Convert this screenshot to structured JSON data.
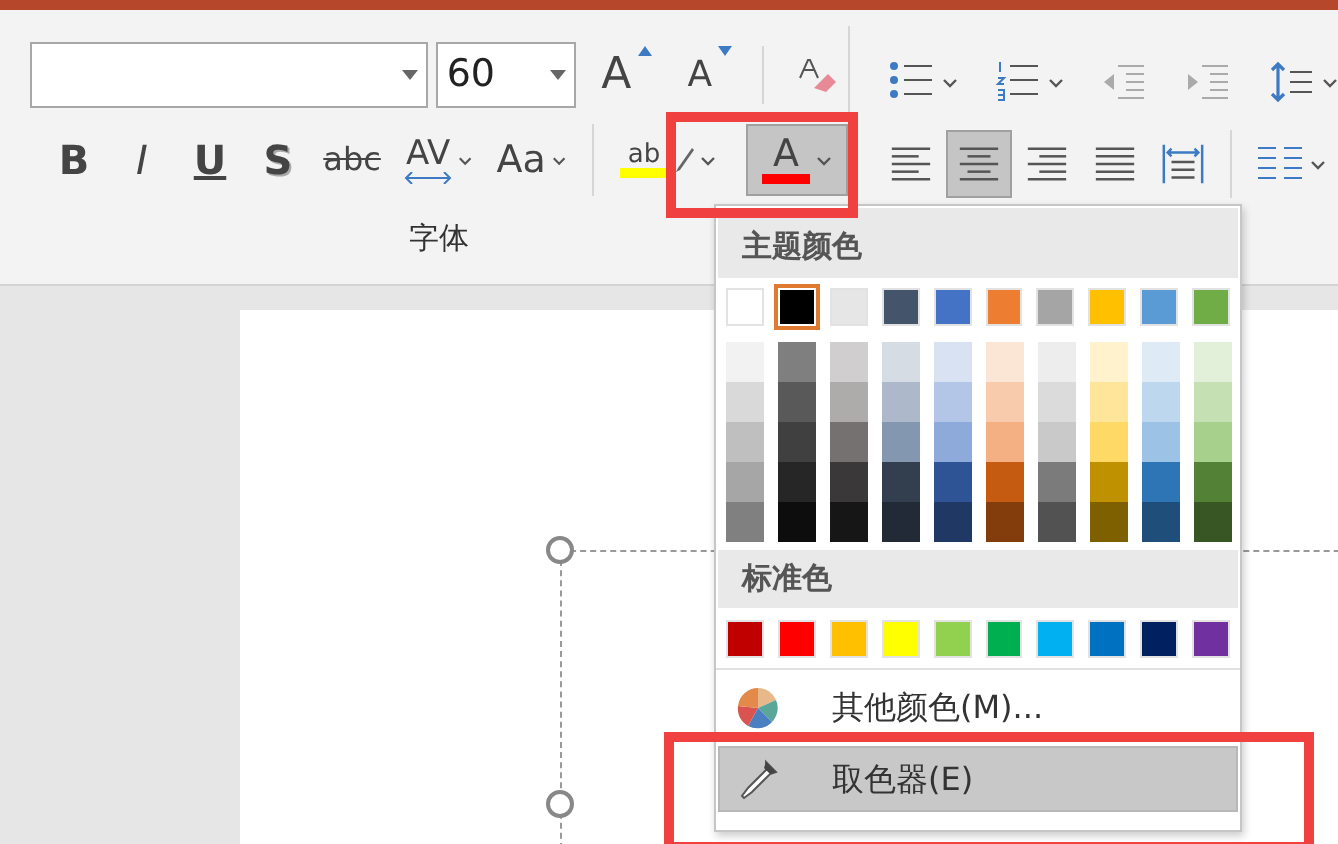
{
  "font_group": {
    "font_size": {
      "value": "60"
    },
    "size_buttons": [
      {
        "kind": "grow",
        "label": "A"
      },
      {
        "kind": "shrink",
        "label": "A"
      }
    ],
    "format_buttons": [
      {
        "kind": "bold",
        "label": "B"
      },
      {
        "kind": "italic",
        "label": "I"
      },
      {
        "kind": "underline",
        "label": "U"
      },
      {
        "kind": "shadow",
        "label": "S"
      },
      {
        "kind": "strike",
        "label": "abc"
      },
      {
        "kind": "spacing",
        "label": "AV"
      },
      {
        "kind": "case",
        "label": "Aa"
      }
    ],
    "highlight": {
      "label": "ab",
      "color": "#ffff00"
    },
    "font_color": {
      "label": "A",
      "color": "#ff0000",
      "pressed": true
    },
    "label": "字体"
  },
  "paragraph_group": {
    "list_tools": [
      {
        "kind": "bullets",
        "disabled": false
      },
      {
        "kind": "numbering",
        "disabled": false
      },
      {
        "kind": "outdent",
        "disabled": true
      },
      {
        "kind": "indent",
        "disabled": true
      },
      {
        "kind": "spacing",
        "disabled": false
      }
    ],
    "alignment": [
      {
        "kind": "left",
        "selected": false
      },
      {
        "kind": "center",
        "selected": true
      },
      {
        "kind": "right",
        "selected": false
      },
      {
        "kind": "justify",
        "selected": false
      },
      {
        "kind": "distribute",
        "selected": false
      }
    ]
  },
  "color_menu": {
    "theme_title": "主题颜色",
    "theme_colors": [
      {
        "color": "#ffffff",
        "selected": false,
        "shades": [
          {
            "color": "#f2f2f2"
          },
          {
            "color": "#d9d9d9"
          },
          {
            "color": "#bfbfbf"
          },
          {
            "color": "#a6a6a6"
          },
          {
            "color": "#808080"
          }
        ]
      },
      {
        "color": "#000000",
        "selected": true,
        "shades": [
          {
            "color": "#7f7f7f"
          },
          {
            "color": "#595959"
          },
          {
            "color": "#404040"
          },
          {
            "color": "#262626"
          },
          {
            "color": "#0d0d0d"
          }
        ]
      },
      {
        "color": "#e7e6e6",
        "selected": false,
        "shades": [
          {
            "color": "#d0cece"
          },
          {
            "color": "#aeabab"
          },
          {
            "color": "#757171"
          },
          {
            "color": "#3a3838"
          },
          {
            "color": "#171616"
          }
        ]
      },
      {
        "color": "#44546a",
        "selected": false,
        "shades": [
          {
            "color": "#d6dce4"
          },
          {
            "color": "#adb9ca"
          },
          {
            "color": "#8497b0"
          },
          {
            "color": "#333f4f"
          },
          {
            "color": "#222a35"
          }
        ]
      },
      {
        "color": "#4472c4",
        "selected": false,
        "shades": [
          {
            "color": "#d9e2f3"
          },
          {
            "color": "#b4c6e7"
          },
          {
            "color": "#8eaadb"
          },
          {
            "color": "#2f5496"
          },
          {
            "color": "#1f3864"
          }
        ]
      },
      {
        "color": "#ed7d31",
        "selected": false,
        "shades": [
          {
            "color": "#fbe5d5"
          },
          {
            "color": "#f7cbac"
          },
          {
            "color": "#f4b083"
          },
          {
            "color": "#c55a11"
          },
          {
            "color": "#833c0b"
          }
        ]
      },
      {
        "color": "#a5a5a5",
        "selected": false,
        "shades": [
          {
            "color": "#ededed"
          },
          {
            "color": "#dbdbdb"
          },
          {
            "color": "#c9c9c9"
          },
          {
            "color": "#7b7b7b"
          },
          {
            "color": "#525252"
          }
        ]
      },
      {
        "color": "#ffc000",
        "selected": false,
        "shades": [
          {
            "color": "#fff2cc"
          },
          {
            "color": "#fee599"
          },
          {
            "color": "#ffd965"
          },
          {
            "color": "#bf9000"
          },
          {
            "color": "#7f6000"
          }
        ]
      },
      {
        "color": "#5b9bd5",
        "selected": false,
        "shades": [
          {
            "color": "#deebf6"
          },
          {
            "color": "#bdd7ee"
          },
          {
            "color": "#9cc3e5"
          },
          {
            "color": "#2e75b5"
          },
          {
            "color": "#1e4e79"
          }
        ]
      },
      {
        "color": "#70ad47",
        "selected": false,
        "shades": [
          {
            "color": "#e2efd9"
          },
          {
            "color": "#c5e0b3"
          },
          {
            "color": "#a8d08d"
          },
          {
            "color": "#538135"
          },
          {
            "color": "#375623"
          }
        ]
      }
    ],
    "standard_title": "标准色",
    "standard_colors": [
      {
        "color": "#c00000"
      },
      {
        "color": "#ff0000"
      },
      {
        "color": "#ffc000"
      },
      {
        "color": "#ffff00"
      },
      {
        "color": "#92d050"
      },
      {
        "color": "#00b050"
      },
      {
        "color": "#00b0f0"
      },
      {
        "color": "#0070c0"
      },
      {
        "color": "#002060"
      },
      {
        "color": "#7030a0"
      }
    ],
    "items": [
      {
        "kind": "palette",
        "label": "其他颜色(M)...",
        "selected": false
      },
      {
        "kind": "eyedropper",
        "label": "取色器(E)",
        "selected": true
      }
    ]
  }
}
